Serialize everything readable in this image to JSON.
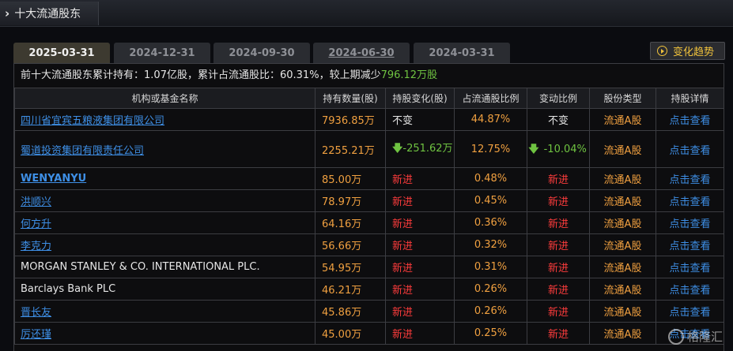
{
  "window": {
    "title": "十大流通股东"
  },
  "tabs": [
    {
      "label": "2025-03-31",
      "active": true
    },
    {
      "label": "2024-12-31"
    },
    {
      "label": "2024-09-30"
    },
    {
      "label": "2024-06-30"
    },
    {
      "label": "2024-03-31"
    }
  ],
  "trend_button": "变化趋势",
  "summary": {
    "prefix": "前十大流通股东累计持有：",
    "total": "1.07亿股",
    "mid": "，累计占流通股比：",
    "ratio": "60.31%",
    "mid2": "，较上期减少",
    "change": "796.12万股"
  },
  "table": {
    "headers": [
      "机构或基金名称",
      "持有数量(股)",
      "持股变化(股)",
      "占流通股比例",
      "变动比例",
      "股份类型",
      "持股详情"
    ],
    "rows": [
      {
        "name": "四川省宜宾五粮液集团有限公司",
        "amount": "7936.85万",
        "change": "不变",
        "ratio": "44.87%",
        "change_ratio": "不变",
        "type": "流通A股",
        "detail": "点击查看"
      },
      {
        "name": "蜀道投资集团有限责任公司",
        "amount": "2255.21万",
        "change": "-251.62万",
        "ratio": "12.75%",
        "change_ratio": "-10.04%",
        "type": "流通A股",
        "detail": "点击查看"
      },
      {
        "name": "WENYANYU",
        "amount": "85.00万",
        "change": "新进",
        "ratio": "0.48%",
        "change_ratio": "新进",
        "type": "流通A股",
        "detail": "点击查看"
      },
      {
        "name": "洪顺兴",
        "amount": "78.97万",
        "change": "新进",
        "ratio": "0.45%",
        "change_ratio": "新进",
        "type": "流通A股",
        "detail": "点击查看"
      },
      {
        "name": "何方升",
        "amount": "64.16万",
        "change": "新进",
        "ratio": "0.36%",
        "change_ratio": "新进",
        "type": "流通A股",
        "detail": "点击查看"
      },
      {
        "name": "李克力",
        "amount": "56.66万",
        "change": "新进",
        "ratio": "0.32%",
        "change_ratio": "新进",
        "type": "流通A股",
        "detail": "点击查看"
      },
      {
        "name": "MORGAN STANLEY & CO. INTERNATIONAL PLC.",
        "amount": "54.95万",
        "change": "新进",
        "ratio": "0.31%",
        "change_ratio": "新进",
        "type": "流通A股",
        "detail": "点击查看"
      },
      {
        "name": "Barclays Bank PLC",
        "amount": "46.21万",
        "change": "新进",
        "ratio": "0.26%",
        "change_ratio": "新进",
        "type": "流通A股",
        "detail": "点击查看"
      },
      {
        "name": "晋长友",
        "amount": "45.86万",
        "change": "新进",
        "ratio": "0.26%",
        "change_ratio": "新进",
        "type": "流通A股",
        "detail": "点击查看"
      },
      {
        "name": "厉还瑾",
        "amount": "45.00万",
        "change": "新进",
        "ratio": "0.25%",
        "change_ratio": "新进",
        "type": "流通A股",
        "detail": "点击查看"
      }
    ]
  },
  "watermark": "格隆汇",
  "colors": {
    "increase": "#ff3c3c",
    "decrease": "#6fc341",
    "link": "#3e8fe6",
    "amount": "#f0a040"
  }
}
